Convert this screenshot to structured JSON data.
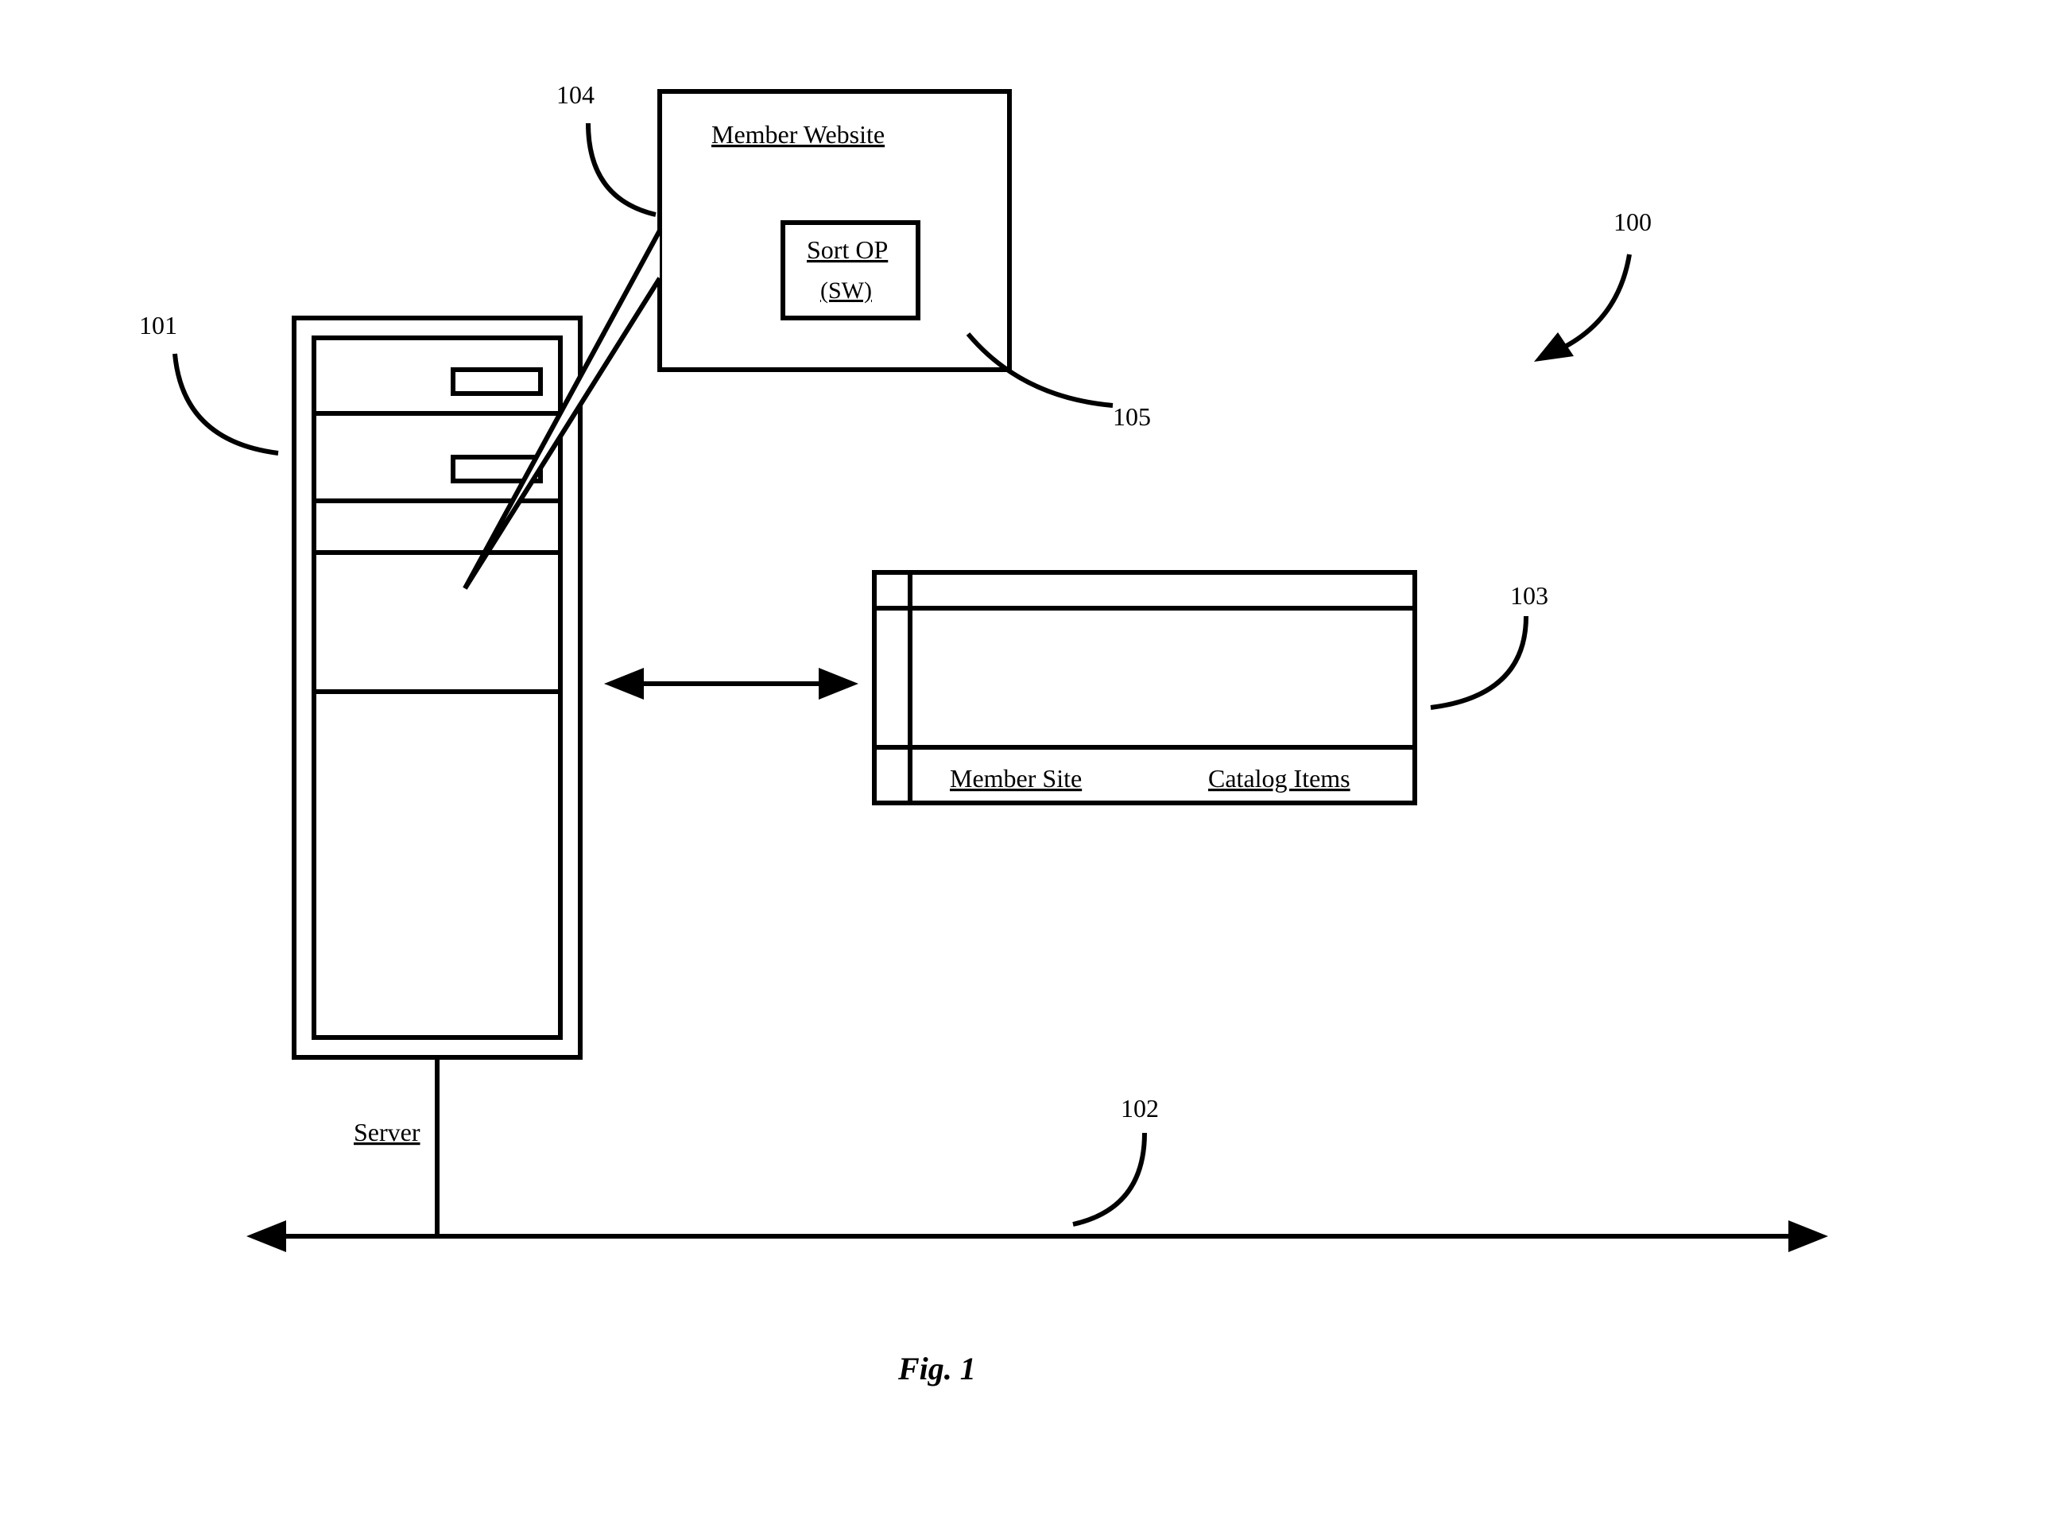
{
  "figure_label": "Fig. 1",
  "refs": {
    "system": "100",
    "server": "101",
    "network": "102",
    "db": "103",
    "website": "104",
    "sort": "105"
  },
  "labels": {
    "server": "Server",
    "member_website": "Member Website",
    "sort_op_line1": "Sort OP",
    "sort_op_line2": "(SW)",
    "member_site": "Member Site",
    "catalog_items": "Catalog Items"
  }
}
